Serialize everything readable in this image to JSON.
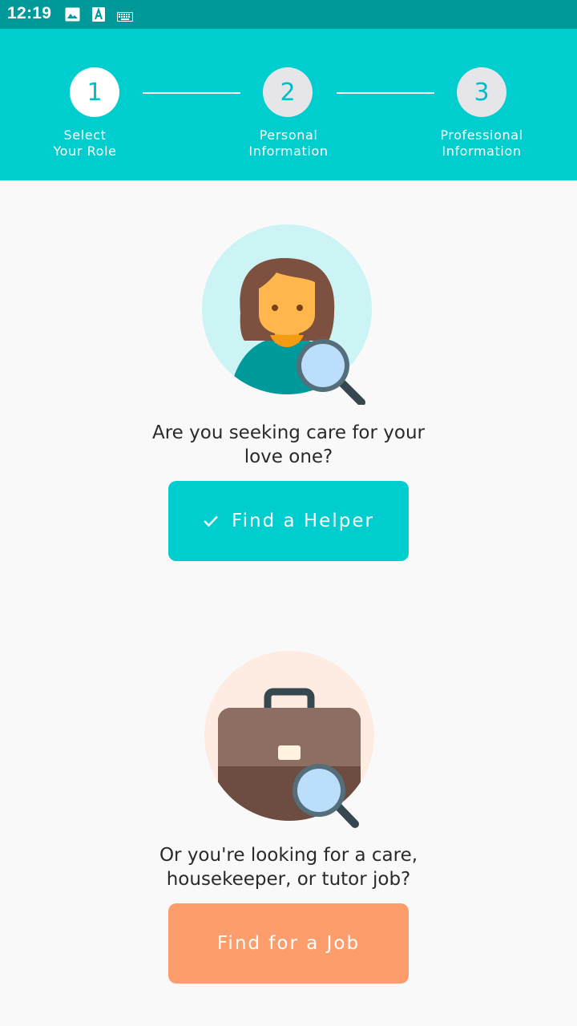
{
  "status_bar": {
    "time": "12:19",
    "icons": [
      "image-icon",
      "text-a-icon",
      "keyboard-icon"
    ]
  },
  "stepper": {
    "steps": [
      {
        "number": "1",
        "label_line1": "Select",
        "label_line2": "Your Role",
        "state": "active"
      },
      {
        "number": "2",
        "label_line1": "Personal",
        "label_line2": "Information",
        "state": "inactive"
      },
      {
        "number": "3",
        "label_line1": "Professional",
        "label_line2": "Information",
        "state": "inactive"
      }
    ]
  },
  "seeker": {
    "question_line1": "Are you seeking care for your",
    "question_line2": "love one?",
    "button_label": "Find a Helper",
    "button_icon": "check-icon"
  },
  "job": {
    "question_line1": "Or you're looking for a care,",
    "question_line2": "housekeeper, or tutor job?",
    "button_label": "Find for a Job"
  },
  "colors": {
    "status_bar": "#00999a",
    "header": "#00cdcd",
    "helper_button": "#00cdcd",
    "job_button": "#fc9d6b",
    "background": "#f9f9f9"
  }
}
